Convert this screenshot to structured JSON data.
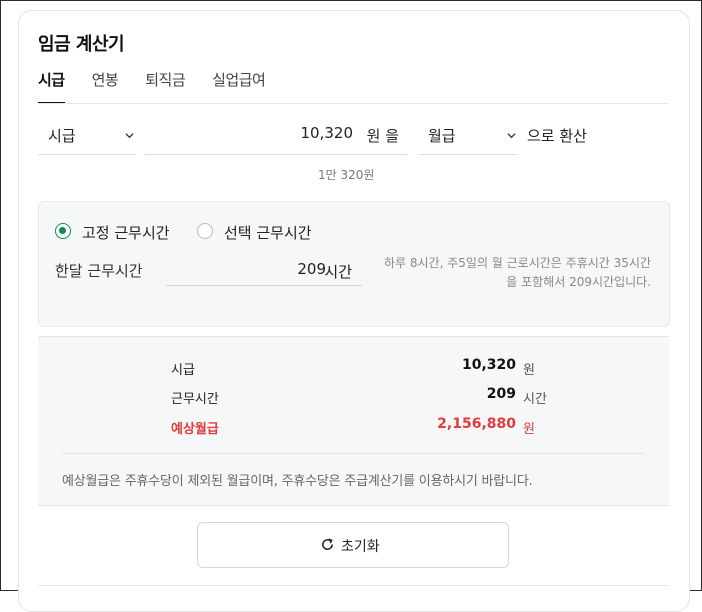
{
  "calculator_title": "임금 계산기",
  "tabs": [
    {
      "label": "시급",
      "active": true
    },
    {
      "label": "연봉",
      "active": false
    },
    {
      "label": "퇴직금",
      "active": false
    },
    {
      "label": "실업급여",
      "active": false
    }
  ],
  "converter": {
    "from_unit": "시급",
    "amount": "10,320",
    "amount_unit": "원 을",
    "to_unit": "월급",
    "suffix": "으로 환산",
    "amount_korean": "1만 320원"
  },
  "work_hours": {
    "options": [
      {
        "label": "고정 근무시간",
        "selected": true
      },
      {
        "label": "선택 근무시간",
        "selected": false
      }
    ],
    "monthly_label": "한달 근무시간",
    "monthly_value": "209",
    "monthly_unit": "시간",
    "note": "하루 8시간, 주5일의 월 근로시간은 주휴시간 35시간을 포함해서 209시간입니다."
  },
  "result": {
    "rows": [
      {
        "label": "시급",
        "value": "10,320",
        "unit": "원"
      },
      {
        "label": "근무시간",
        "value": "209",
        "unit": "시간"
      },
      {
        "label": "예상월급",
        "value": "2,156,880",
        "unit": "원"
      }
    ],
    "note": "예상월급은 주휴수당이 제외된 월급이며, 주휴수당은 주급계산기를 이용하시기 바랍니다."
  },
  "reset_label": "초기화",
  "colors": {
    "accent_green": "#0e8a4e",
    "highlight_red": "#e03c3c"
  }
}
